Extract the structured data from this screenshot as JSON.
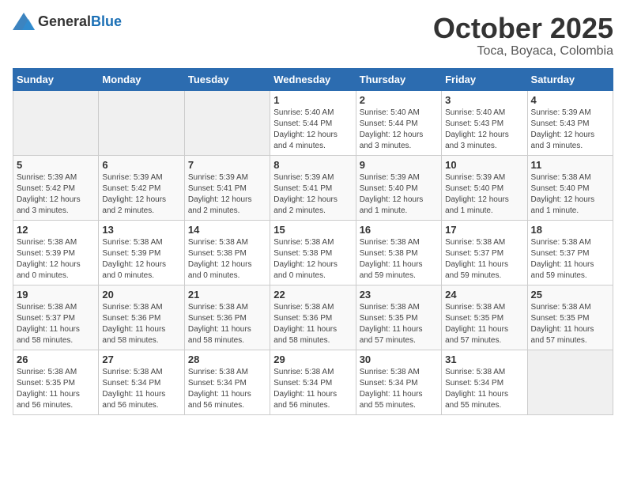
{
  "header": {
    "logo_general": "General",
    "logo_blue": "Blue",
    "month": "October 2025",
    "location": "Toca, Boyaca, Colombia"
  },
  "days_of_week": [
    "Sunday",
    "Monday",
    "Tuesday",
    "Wednesday",
    "Thursday",
    "Friday",
    "Saturday"
  ],
  "weeks": [
    [
      {
        "day": "",
        "info": ""
      },
      {
        "day": "",
        "info": ""
      },
      {
        "day": "",
        "info": ""
      },
      {
        "day": "1",
        "info": "Sunrise: 5:40 AM\nSunset: 5:44 PM\nDaylight: 12 hours\nand 4 minutes."
      },
      {
        "day": "2",
        "info": "Sunrise: 5:40 AM\nSunset: 5:44 PM\nDaylight: 12 hours\nand 3 minutes."
      },
      {
        "day": "3",
        "info": "Sunrise: 5:40 AM\nSunset: 5:43 PM\nDaylight: 12 hours\nand 3 minutes."
      },
      {
        "day": "4",
        "info": "Sunrise: 5:39 AM\nSunset: 5:43 PM\nDaylight: 12 hours\nand 3 minutes."
      }
    ],
    [
      {
        "day": "5",
        "info": "Sunrise: 5:39 AM\nSunset: 5:42 PM\nDaylight: 12 hours\nand 3 minutes."
      },
      {
        "day": "6",
        "info": "Sunrise: 5:39 AM\nSunset: 5:42 PM\nDaylight: 12 hours\nand 2 minutes."
      },
      {
        "day": "7",
        "info": "Sunrise: 5:39 AM\nSunset: 5:41 PM\nDaylight: 12 hours\nand 2 minutes."
      },
      {
        "day": "8",
        "info": "Sunrise: 5:39 AM\nSunset: 5:41 PM\nDaylight: 12 hours\nand 2 minutes."
      },
      {
        "day": "9",
        "info": "Sunrise: 5:39 AM\nSunset: 5:40 PM\nDaylight: 12 hours\nand 1 minute."
      },
      {
        "day": "10",
        "info": "Sunrise: 5:39 AM\nSunset: 5:40 PM\nDaylight: 12 hours\nand 1 minute."
      },
      {
        "day": "11",
        "info": "Sunrise: 5:38 AM\nSunset: 5:40 PM\nDaylight: 12 hours\nand 1 minute."
      }
    ],
    [
      {
        "day": "12",
        "info": "Sunrise: 5:38 AM\nSunset: 5:39 PM\nDaylight: 12 hours\nand 0 minutes."
      },
      {
        "day": "13",
        "info": "Sunrise: 5:38 AM\nSunset: 5:39 PM\nDaylight: 12 hours\nand 0 minutes."
      },
      {
        "day": "14",
        "info": "Sunrise: 5:38 AM\nSunset: 5:38 PM\nDaylight: 12 hours\nand 0 minutes."
      },
      {
        "day": "15",
        "info": "Sunrise: 5:38 AM\nSunset: 5:38 PM\nDaylight: 12 hours\nand 0 minutes."
      },
      {
        "day": "16",
        "info": "Sunrise: 5:38 AM\nSunset: 5:38 PM\nDaylight: 11 hours\nand 59 minutes."
      },
      {
        "day": "17",
        "info": "Sunrise: 5:38 AM\nSunset: 5:37 PM\nDaylight: 11 hours\nand 59 minutes."
      },
      {
        "day": "18",
        "info": "Sunrise: 5:38 AM\nSunset: 5:37 PM\nDaylight: 11 hours\nand 59 minutes."
      }
    ],
    [
      {
        "day": "19",
        "info": "Sunrise: 5:38 AM\nSunset: 5:37 PM\nDaylight: 11 hours\nand 58 minutes."
      },
      {
        "day": "20",
        "info": "Sunrise: 5:38 AM\nSunset: 5:36 PM\nDaylight: 11 hours\nand 58 minutes."
      },
      {
        "day": "21",
        "info": "Sunrise: 5:38 AM\nSunset: 5:36 PM\nDaylight: 11 hours\nand 58 minutes."
      },
      {
        "day": "22",
        "info": "Sunrise: 5:38 AM\nSunset: 5:36 PM\nDaylight: 11 hours\nand 58 minutes."
      },
      {
        "day": "23",
        "info": "Sunrise: 5:38 AM\nSunset: 5:35 PM\nDaylight: 11 hours\nand 57 minutes."
      },
      {
        "day": "24",
        "info": "Sunrise: 5:38 AM\nSunset: 5:35 PM\nDaylight: 11 hours\nand 57 minutes."
      },
      {
        "day": "25",
        "info": "Sunrise: 5:38 AM\nSunset: 5:35 PM\nDaylight: 11 hours\nand 57 minutes."
      }
    ],
    [
      {
        "day": "26",
        "info": "Sunrise: 5:38 AM\nSunset: 5:35 PM\nDaylight: 11 hours\nand 56 minutes."
      },
      {
        "day": "27",
        "info": "Sunrise: 5:38 AM\nSunset: 5:34 PM\nDaylight: 11 hours\nand 56 minutes."
      },
      {
        "day": "28",
        "info": "Sunrise: 5:38 AM\nSunset: 5:34 PM\nDaylight: 11 hours\nand 56 minutes."
      },
      {
        "day": "29",
        "info": "Sunrise: 5:38 AM\nSunset: 5:34 PM\nDaylight: 11 hours\nand 56 minutes."
      },
      {
        "day": "30",
        "info": "Sunrise: 5:38 AM\nSunset: 5:34 PM\nDaylight: 11 hours\nand 55 minutes."
      },
      {
        "day": "31",
        "info": "Sunrise: 5:38 AM\nSunset: 5:34 PM\nDaylight: 11 hours\nand 55 minutes."
      },
      {
        "day": "",
        "info": ""
      }
    ]
  ]
}
